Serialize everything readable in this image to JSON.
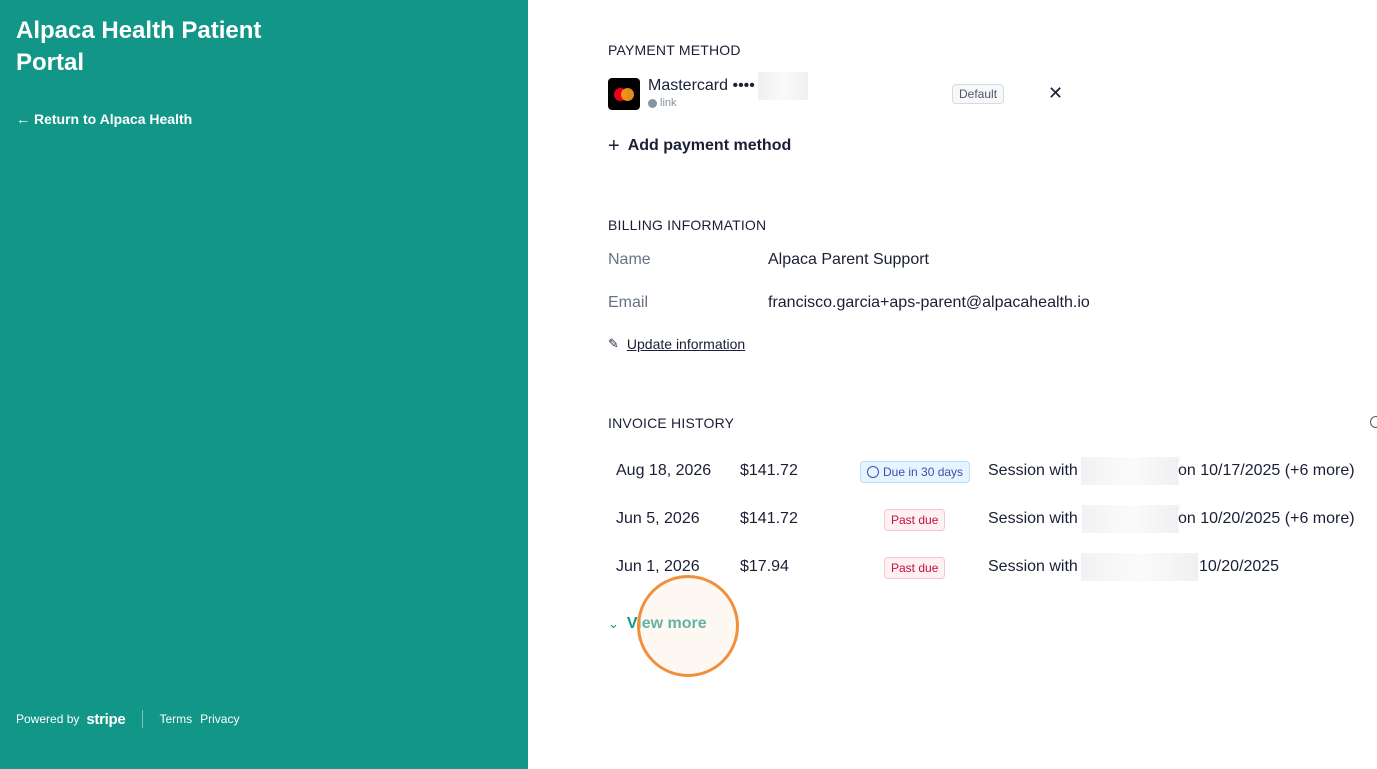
{
  "sidebar": {
    "title": "Alpaca Health Patient Portal",
    "return_link": "Return to Alpaca Health",
    "footer": {
      "powered_by": "Powered by",
      "stripe": "stripe",
      "terms": "Terms",
      "privacy": "Privacy"
    }
  },
  "payment_method": {
    "title": "PAYMENT METHOD",
    "card": {
      "name": "Mastercard ••••",
      "sub": "link",
      "badge": "Default"
    },
    "add_label": "Add payment method"
  },
  "billing": {
    "title": "BILLING INFORMATION",
    "name_label": "Name",
    "name_value": "Alpaca Parent Support",
    "email_label": "Email",
    "email_value": "francisco.garcia+aps-parent@alpacahealth.io",
    "update_label": "Update information"
  },
  "invoices": {
    "title": "INVOICE HISTORY",
    "rows": [
      {
        "date": "Aug 18, 2026",
        "amount": "$141.72",
        "status": "Due in 30 days",
        "desc_a": "Session with",
        "desc_b": "on 10/17/2025 (+6 more)"
      },
      {
        "date": "Jun 5, 2026",
        "amount": "$141.72",
        "status": "Past due",
        "desc_a": "Session with",
        "desc_b": "on 10/20/2025 (+6 more)"
      },
      {
        "date": "Jun 1, 2026",
        "amount": "$17.94",
        "status": "Past due",
        "desc_a": "Session with",
        "desc_b": "10/20/2025"
      }
    ],
    "view_more": "View more"
  },
  "colors": {
    "brand": "#129688",
    "past_due": "#c0123c",
    "due_soon": "#3d4eac",
    "click_indicator": "#f0903d"
  }
}
